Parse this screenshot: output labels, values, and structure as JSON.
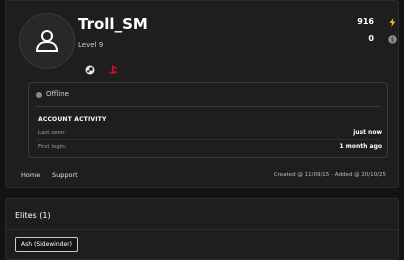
{
  "profile": {
    "name": "Troll_SM",
    "level": "Level 9",
    "platform_icons": [
      "steam-icon",
      "playstation-icon"
    ],
    "stats": [
      {
        "value": "916",
        "icon": "lightning-icon",
        "color": "#f2c12e"
      },
      {
        "value": "0",
        "icon": "coin-icon",
        "color": "#9a9a9a"
      }
    ]
  },
  "status": {
    "state": "Offline",
    "activity_title": "ACCOUNT ACTIVITY",
    "last_seen_label": "Last seen:",
    "last_seen_value": "just now",
    "first_login_label": "First login:",
    "first_login_value": "1 month ago"
  },
  "nav": {
    "home": "Home",
    "support": "Support"
  },
  "created_text": "Created @ 11/09/15 - Added @ 20/10/25",
  "elites": {
    "title": "Elites (1)",
    "items": [
      "Ash (Sidewinder)"
    ]
  },
  "colors": {
    "accent": "#f2c12e",
    "playstation": "#c8102e",
    "background": "#131313",
    "card": "#1e1e1e"
  }
}
